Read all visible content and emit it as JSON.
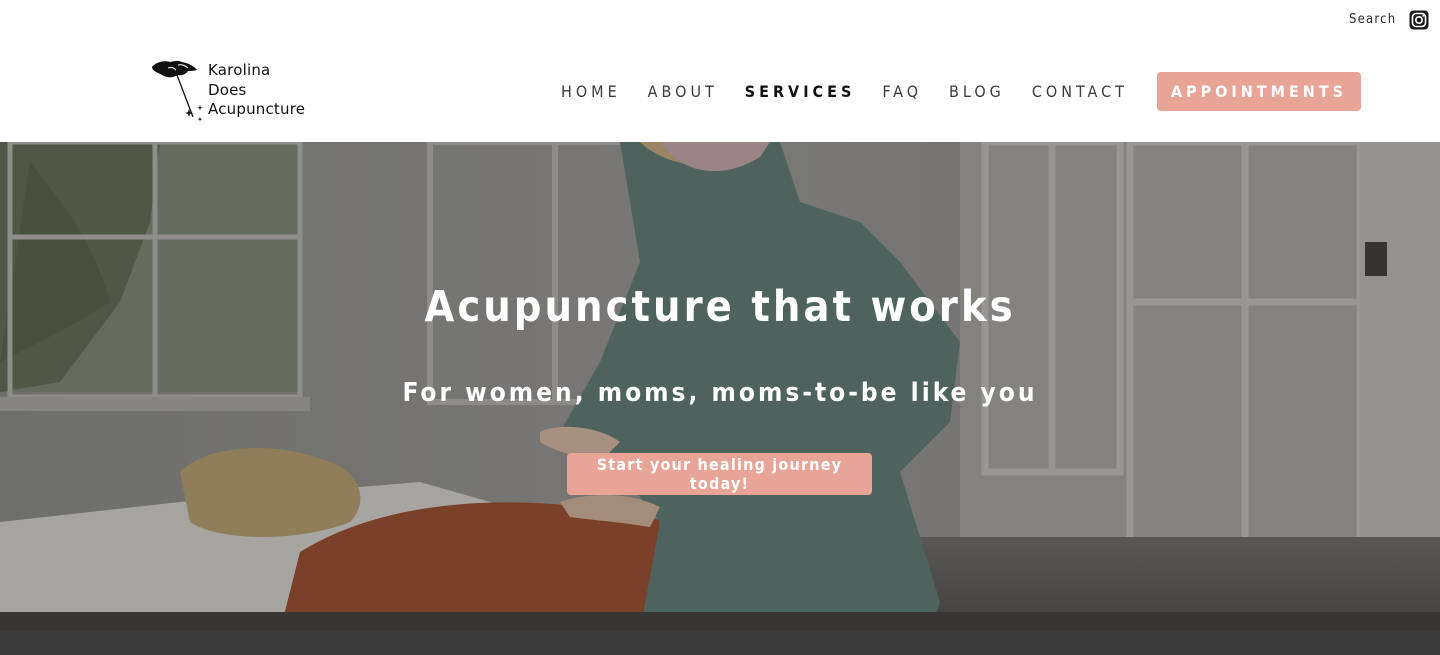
{
  "utility": {
    "search_label": "Search",
    "instagram_icon": "instagram-icon"
  },
  "header": {
    "logo": {
      "line1": "Karolina",
      "line2": "Does",
      "line3": "Acupuncture"
    },
    "nav": [
      {
        "label": "HOME",
        "active": false
      },
      {
        "label": "ABOUT",
        "active": false
      },
      {
        "label": "SERVICES",
        "active": true
      },
      {
        "label": "FAQ",
        "active": false
      },
      {
        "label": "BLOG",
        "active": false
      },
      {
        "label": "CONTACT",
        "active": false
      }
    ],
    "appointments_label": "APPOINTMENTS"
  },
  "hero": {
    "title": "Acupuncture that works",
    "subtitle": "For women, moms, moms-to-be like you",
    "cta_label": "Start your healing journey today!"
  },
  "colors": {
    "accent": "#e8a497",
    "text_dark": "#3a3a3a",
    "footer": "#3a3a3a"
  }
}
